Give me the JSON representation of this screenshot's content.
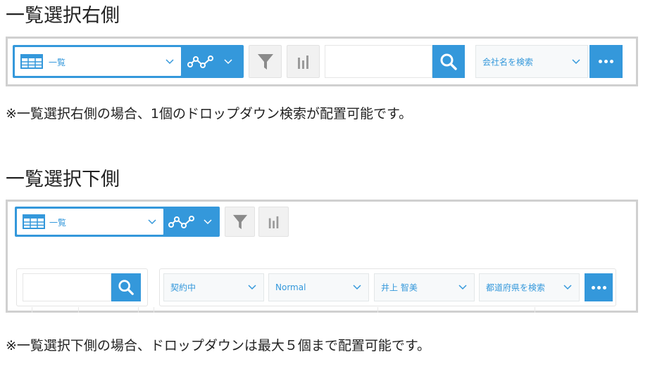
{
  "section_right": {
    "heading": "一覧選択右側",
    "view_label": "一覧",
    "search_value": "",
    "dropdown_label": "会社名を検索",
    "note": "※一覧選択右側の場合、1個のドロップダウン検索が配置可能です。"
  },
  "section_below": {
    "heading": "一覧選択下側",
    "view_label": "一覧",
    "search_value": "",
    "dropdowns": [
      {
        "label": "契約中"
      },
      {
        "label": "Normal"
      },
      {
        "label": "井上 智美"
      },
      {
        "label": "都道府県を検索"
      }
    ],
    "note": "※一覧選択下側の場合、ドロップダウンは最大５個まで配置可能です。"
  },
  "icons": {
    "view": "grid-list-icon",
    "graph": "graph-icon",
    "filter": "funnel-icon",
    "chart": "bar-chart-icon",
    "search": "magnifier-icon",
    "more": "ellipsis-icon",
    "dropdown": "chevron-down-icon"
  },
  "colors": {
    "accent": "#3498db",
    "button_gray": "#f1f1f1",
    "panel_border": "#d0d0d0"
  }
}
